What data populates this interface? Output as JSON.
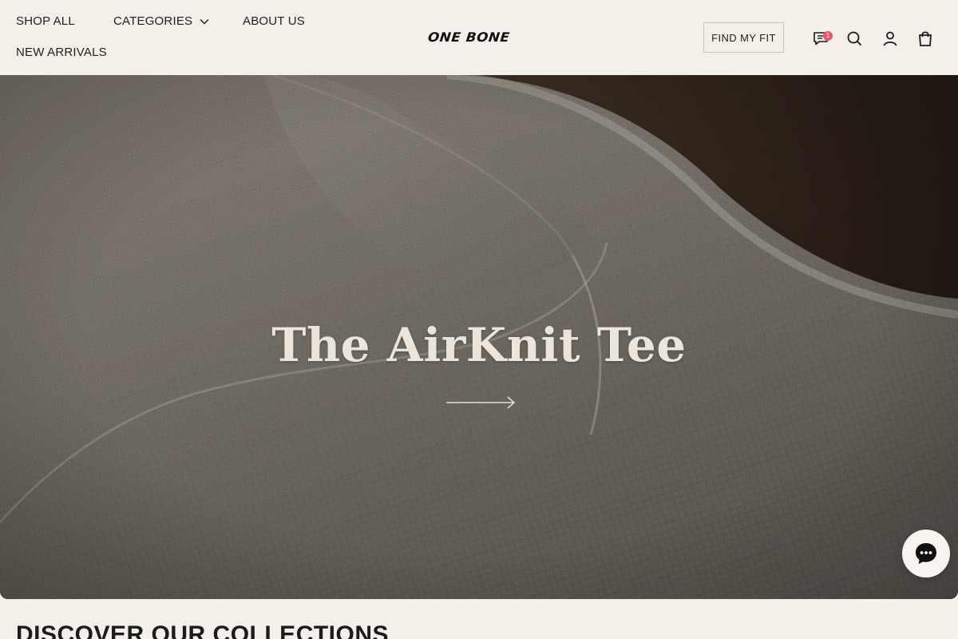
{
  "nav": {
    "shop_all": "SHOP ALL",
    "categories": "CATEGORIES",
    "about_us": "ABOUT US",
    "new_arrivals": "NEW ARRIVALS"
  },
  "brand": {
    "logo_text": "ONE BONE"
  },
  "header_actions": {
    "find_my_fit": "FIND MY FIT",
    "chat_badge": "1",
    "icons": [
      "chat-icon",
      "search-icon",
      "account-icon",
      "bag-icon"
    ]
  },
  "hero": {
    "title": "The AirKnit Tee",
    "cta_icon": "arrow-right-icon"
  },
  "sections": {
    "collections_title": "DISCOVER OUR COLLECTIONS"
  },
  "colors": {
    "background": "#f4efe8",
    "accent_border": "#d1c3a8",
    "badge": "#e85a6b",
    "hero_text": "#ece5d9"
  }
}
